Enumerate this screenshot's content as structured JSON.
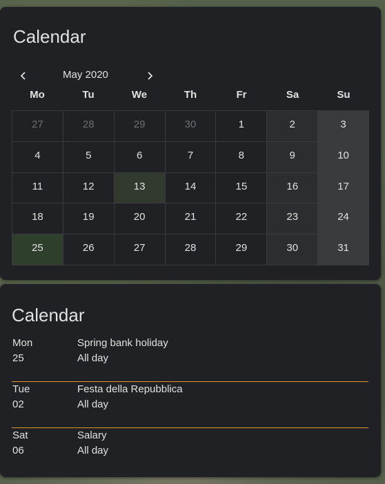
{
  "month_card": {
    "title": "Calendar",
    "month_label": "May 2020",
    "weekdays": [
      "Mo",
      "Tu",
      "We",
      "Th",
      "Fr",
      "Sa",
      "Su"
    ],
    "weeks": [
      [
        {
          "d": "27",
          "other": true
        },
        {
          "d": "28",
          "other": true
        },
        {
          "d": "29",
          "other": true
        },
        {
          "d": "30",
          "other": true
        },
        {
          "d": "1"
        },
        {
          "d": "2"
        },
        {
          "d": "3"
        }
      ],
      [
        {
          "d": "4"
        },
        {
          "d": "5"
        },
        {
          "d": "6"
        },
        {
          "d": "7"
        },
        {
          "d": "8"
        },
        {
          "d": "9"
        },
        {
          "d": "10"
        }
      ],
      [
        {
          "d": "11"
        },
        {
          "d": "12"
        },
        {
          "d": "13",
          "today": true
        },
        {
          "d": "14"
        },
        {
          "d": "15"
        },
        {
          "d": "16"
        },
        {
          "d": "17"
        }
      ],
      [
        {
          "d": "18"
        },
        {
          "d": "19"
        },
        {
          "d": "20"
        },
        {
          "d": "21"
        },
        {
          "d": "22"
        },
        {
          "d": "23"
        },
        {
          "d": "24"
        }
      ],
      [
        {
          "d": "25",
          "selected": true
        },
        {
          "d": "26"
        },
        {
          "d": "27"
        },
        {
          "d": "28"
        },
        {
          "d": "29"
        },
        {
          "d": "30"
        },
        {
          "d": "31"
        }
      ]
    ],
    "icons": {
      "prev": "chevron-left-icon",
      "next": "chevron-right-icon"
    }
  },
  "list_card": {
    "title": "Calendar",
    "events": [
      {
        "day": "Mon",
        "date": "25",
        "title": "Spring bank holiday",
        "time": "All day"
      },
      {
        "day": "Tue",
        "date": "02",
        "title": "Festa della Repubblica",
        "time": "All day"
      },
      {
        "day": "Sat",
        "date": "06",
        "title": "Salary",
        "time": "All day"
      }
    ]
  },
  "colors": {
    "card_bg": "#202124",
    "text": "#e1e1e1",
    "separator": "#e6952d",
    "today_bg": "#323a2f",
    "selected_bg": "#2e3f2c",
    "saturday_bg": "#2c2d31",
    "sunday_bg": "#3a3b3f"
  }
}
